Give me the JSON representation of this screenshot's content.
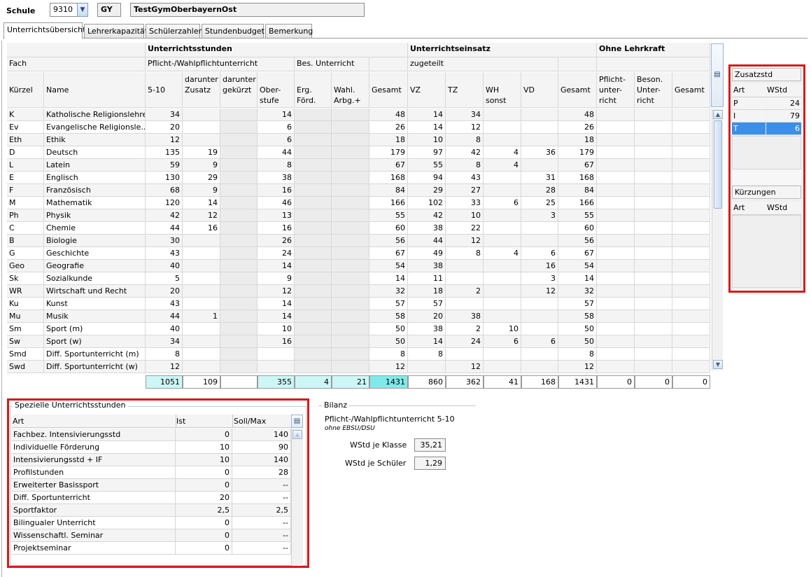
{
  "header": {
    "school_label": "Schule",
    "school_number": "9310",
    "school_type": "GY",
    "school_name": "TestGymOberbayernOst"
  },
  "tabs": [
    "Unterrichtsübersicht",
    "Lehrerkapazität",
    "Schülerzahlen",
    "Stundenbudget",
    "Bemerkung"
  ],
  "active_tab": 0,
  "main_table": {
    "groups": {
      "unterrichtsstunden": "Unterrichtsstunden",
      "unterrichtseinsatz": "Unterrichtseinsatz",
      "ohne_lehrkraft": "Ohne Lehrkraft"
    },
    "subgroups": {
      "fach": "Fach",
      "pflicht": "Pflicht-/Wahlpflichtunterricht",
      "bes": "Bes. Unterricht",
      "zugeteilt": "zugeteilt"
    },
    "columns": [
      "Kürzel",
      "Name",
      "5-10",
      "darunter Zusatz",
      "darunter gekürzt",
      "Ober-stufe",
      "Erg. Förd.",
      "Wahl. Arbg.+",
      "Gesamt",
      "VZ",
      "TZ",
      "WH sonst",
      "VD",
      "Gesamt",
      "Pflicht-unter-richt",
      "Beson. Unter-richt",
      "Gesamt"
    ],
    "rows": [
      [
        "K",
        "Katholische Religionslehre",
        "34",
        "",
        "",
        "14",
        "",
        "",
        "48",
        "14",
        "34",
        "",
        "",
        "48",
        "",
        "",
        ""
      ],
      [
        "Ev",
        "Evangelische Religionsle...",
        "20",
        "",
        "",
        "6",
        "",
        "",
        "26",
        "14",
        "12",
        "",
        "",
        "26",
        "",
        "",
        ""
      ],
      [
        "Eth",
        "Ethik",
        "12",
        "",
        "",
        "6",
        "",
        "",
        "18",
        "10",
        "8",
        "",
        "",
        "18",
        "",
        "",
        ""
      ],
      [
        "D",
        "Deutsch",
        "135",
        "19",
        "",
        "44",
        "",
        "",
        "179",
        "97",
        "42",
        "4",
        "36",
        "179",
        "",
        "",
        ""
      ],
      [
        "L",
        "Latein",
        "59",
        "9",
        "",
        "8",
        "",
        "",
        "67",
        "55",
        "8",
        "4",
        "",
        "67",
        "",
        "",
        ""
      ],
      [
        "E",
        "Englisch",
        "130",
        "29",
        "",
        "38",
        "",
        "",
        "168",
        "94",
        "43",
        "",
        "31",
        "168",
        "",
        "",
        ""
      ],
      [
        "F",
        "Französisch",
        "68",
        "9",
        "",
        "16",
        "",
        "",
        "84",
        "29",
        "27",
        "",
        "28",
        "84",
        "",
        "",
        ""
      ],
      [
        "M",
        "Mathematik",
        "120",
        "14",
        "",
        "46",
        "",
        "",
        "166",
        "102",
        "33",
        "6",
        "25",
        "166",
        "",
        "",
        ""
      ],
      [
        "Ph",
        "Physik",
        "42",
        "12",
        "",
        "13",
        "",
        "",
        "55",
        "42",
        "10",
        "",
        "3",
        "55",
        "",
        "",
        ""
      ],
      [
        "C",
        "Chemie",
        "44",
        "16",
        "",
        "16",
        "",
        "",
        "60",
        "38",
        "22",
        "",
        "",
        "60",
        "",
        "",
        ""
      ],
      [
        "B",
        "Biologie",
        "30",
        "",
        "",
        "26",
        "",
        "",
        "56",
        "44",
        "12",
        "",
        "",
        "56",
        "",
        "",
        ""
      ],
      [
        "G",
        "Geschichte",
        "43",
        "",
        "",
        "24",
        "",
        "",
        "67",
        "49",
        "8",
        "4",
        "6",
        "67",
        "",
        "",
        ""
      ],
      [
        "Geo",
        "Geografie",
        "40",
        "",
        "",
        "14",
        "",
        "",
        "54",
        "38",
        "",
        "",
        "16",
        "54",
        "",
        "",
        ""
      ],
      [
        "Sk",
        "Sozialkunde",
        "5",
        "",
        "",
        "9",
        "",
        "",
        "14",
        "11",
        "",
        "",
        "3",
        "14",
        "",
        "",
        ""
      ],
      [
        "WR",
        "Wirtschaft und Recht",
        "20",
        "",
        "",
        "12",
        "",
        "",
        "32",
        "18",
        "2",
        "",
        "12",
        "32",
        "",
        "",
        ""
      ],
      [
        "Ku",
        "Kunst",
        "43",
        "",
        "",
        "14",
        "",
        "",
        "57",
        "57",
        "",
        "",
        "",
        "57",
        "",
        "",
        ""
      ],
      [
        "Mu",
        "Musik",
        "44",
        "1",
        "",
        "14",
        "",
        "",
        "58",
        "20",
        "38",
        "",
        "",
        "58",
        "",
        "",
        ""
      ],
      [
        "Sm",
        "Sport (m)",
        "40",
        "",
        "",
        "10",
        "",
        "",
        "50",
        "38",
        "2",
        "10",
        "",
        "50",
        "",
        "",
        ""
      ],
      [
        "Sw",
        "Sport (w)",
        "34",
        "",
        "",
        "16",
        "",
        "",
        "50",
        "14",
        "24",
        "6",
        "6",
        "50",
        "",
        "",
        ""
      ],
      [
        "Smd",
        "Diff. Sportunterricht (m)",
        "8",
        "",
        "",
        "",
        "",
        "",
        "8",
        "8",
        "",
        "",
        "",
        "8",
        "",
        "",
        ""
      ],
      [
        "Swd",
        "Diff. Sportunterricht (w)",
        "12",
        "",
        "",
        "",
        "",
        "",
        "12",
        "",
        "12",
        "",
        "",
        "12",
        "",
        "",
        ""
      ]
    ],
    "totals": [
      "1051",
      "109",
      "",
      "355",
      "4",
      "21",
      "1431",
      "860",
      "362",
      "41",
      "168",
      "1431",
      "0",
      "0",
      "0"
    ]
  },
  "zusatz": {
    "title": "Zusatzstd",
    "col_art": "Art",
    "col_wstd": "WStd",
    "rows": [
      [
        "P",
        "24"
      ],
      [
        "I",
        "79"
      ],
      [
        "T",
        "6"
      ]
    ],
    "selected_row": 2
  },
  "kuerzungen": {
    "title": "Kürzungen",
    "col_art": "Art",
    "col_wstd": "WStd"
  },
  "spezielle": {
    "title": "Spezielle Unterrichtsstunden",
    "col_art": "Art",
    "col_ist": "Ist",
    "col_soll": "Soll/Max",
    "rows": [
      [
        "Fachbez. Intensivierungsstd",
        "0",
        "140"
      ],
      [
        "Individuelle Förderung",
        "10",
        "90"
      ],
      [
        "Intensivierungsstd + IF",
        "10",
        "140"
      ],
      [
        "Profilstunden",
        "0",
        "28"
      ],
      [
        "Erweiterter Basissport",
        "0",
        "--"
      ],
      [
        "Diff. Sportunterricht",
        "20",
        "--"
      ],
      [
        "Sportfaktor",
        "2,5",
        "2,5"
      ],
      [
        "Bilingualer Unterricht",
        "0",
        "--"
      ],
      [
        "Wissenschaftl. Seminar",
        "0",
        "--"
      ],
      [
        "Projektseminar",
        "0",
        "--"
      ]
    ]
  },
  "bilanz": {
    "title": "Bilanz",
    "subtitle": "Pflicht-/Wahlpflichtunterricht 5-10",
    "note": "ohne EBSU/DSU",
    "klasse_label": "WStd je Klasse",
    "klasse_value": "35,21",
    "schueler_label": "WStd je Schüler",
    "schueler_value": "1,29"
  },
  "colors": {
    "highlight": "#d81a1a",
    "selection": "#3b8fe8",
    "total_cyan": "#cdf7f7",
    "total_cyan_strong": "#7feaea"
  }
}
